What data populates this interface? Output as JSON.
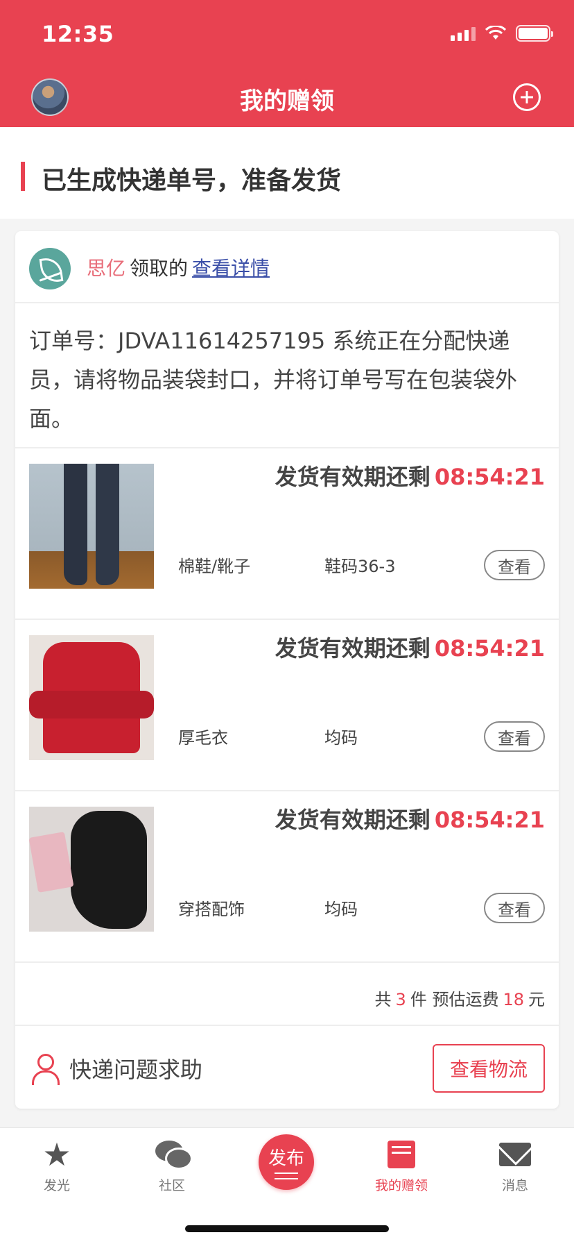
{
  "status_bar": {
    "time": "12:35"
  },
  "header": {
    "title": "我的赠领"
  },
  "section": {
    "title": "已生成快递单号，准备发货"
  },
  "claimer": {
    "name": "思亿",
    "label": "领取的",
    "link": "查看详情"
  },
  "order": {
    "text": "订单号：JDVA11614257195 系统正在分配快递员，请将物品装袋封口，并将订单号写在包装袋外面。"
  },
  "items": [
    {
      "countdown_label": "发货有效期还剩",
      "countdown_time": "08:54:21",
      "name": "棉鞋/靴子",
      "size": "鞋码36-3",
      "view": "查看"
    },
    {
      "countdown_label": "发货有效期还剩",
      "countdown_time": "08:54:21",
      "name": "厚毛衣",
      "size": "均码",
      "view": "查看"
    },
    {
      "countdown_label": "发货有效期还剩",
      "countdown_time": "08:54:21",
      "name": "穿搭配饰",
      "size": "均码",
      "view": "查看"
    }
  ],
  "summary": {
    "prefix": "共",
    "count": "3",
    "mid": "件 预估运费",
    "fee": "18",
    "suffix": "元"
  },
  "help": {
    "label": "快递问题求助",
    "button": "查看物流"
  },
  "tabbar": {
    "tabs": [
      {
        "label": "发光",
        "icon": "star-icon"
      },
      {
        "label": "社区",
        "icon": "chat-icon"
      },
      {
        "label": "我的赠领",
        "icon": "book-icon",
        "active": true
      },
      {
        "label": "消息",
        "icon": "mail-icon"
      }
    ],
    "publish": "发布"
  },
  "colors": {
    "accent": "#e84251",
    "link": "#3b4fa8",
    "name": "#e86e7a"
  }
}
